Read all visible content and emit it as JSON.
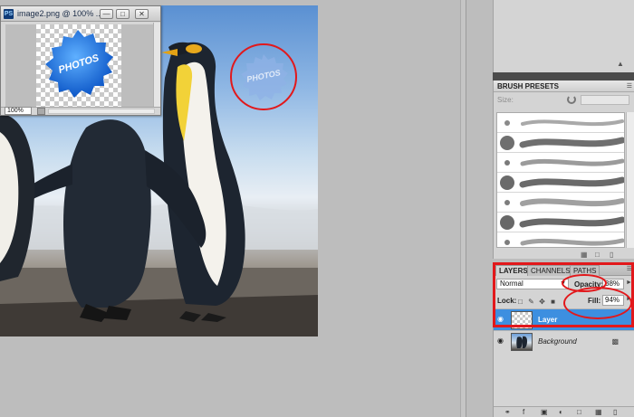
{
  "document_window": {
    "title": "image2.png @ 100% ...",
    "app_icon": "PS",
    "minimize_icon": "minimize-icon",
    "restore_icon": "restore-icon",
    "close_icon": "close-icon",
    "zoom_value": "100%",
    "artwork_text": "PHOTOS",
    "artwork_color": "#1d78e0"
  },
  "canvas": {
    "overlay_badge_text": "PHOTOS"
  },
  "brush_presets": {
    "tab_label": "BRUSH PRESETS",
    "size_label": "Size:",
    "brush_count": 7
  },
  "layers": {
    "tabs": [
      "LAYERS",
      "CHANNELS",
      "PATHS"
    ],
    "blend_mode": "Normal",
    "opacity_label": "Opacity:",
    "opacity_value": "38%",
    "lock_label": "Lock:",
    "fill_label": "Fill:",
    "fill_value": "94%",
    "rows": [
      {
        "name": "Layer",
        "selected": true
      },
      {
        "name": "Background",
        "selected": false
      }
    ]
  },
  "colors": {
    "highlight_red": "#e2181b",
    "selection_blue": "#3d8fe0"
  }
}
